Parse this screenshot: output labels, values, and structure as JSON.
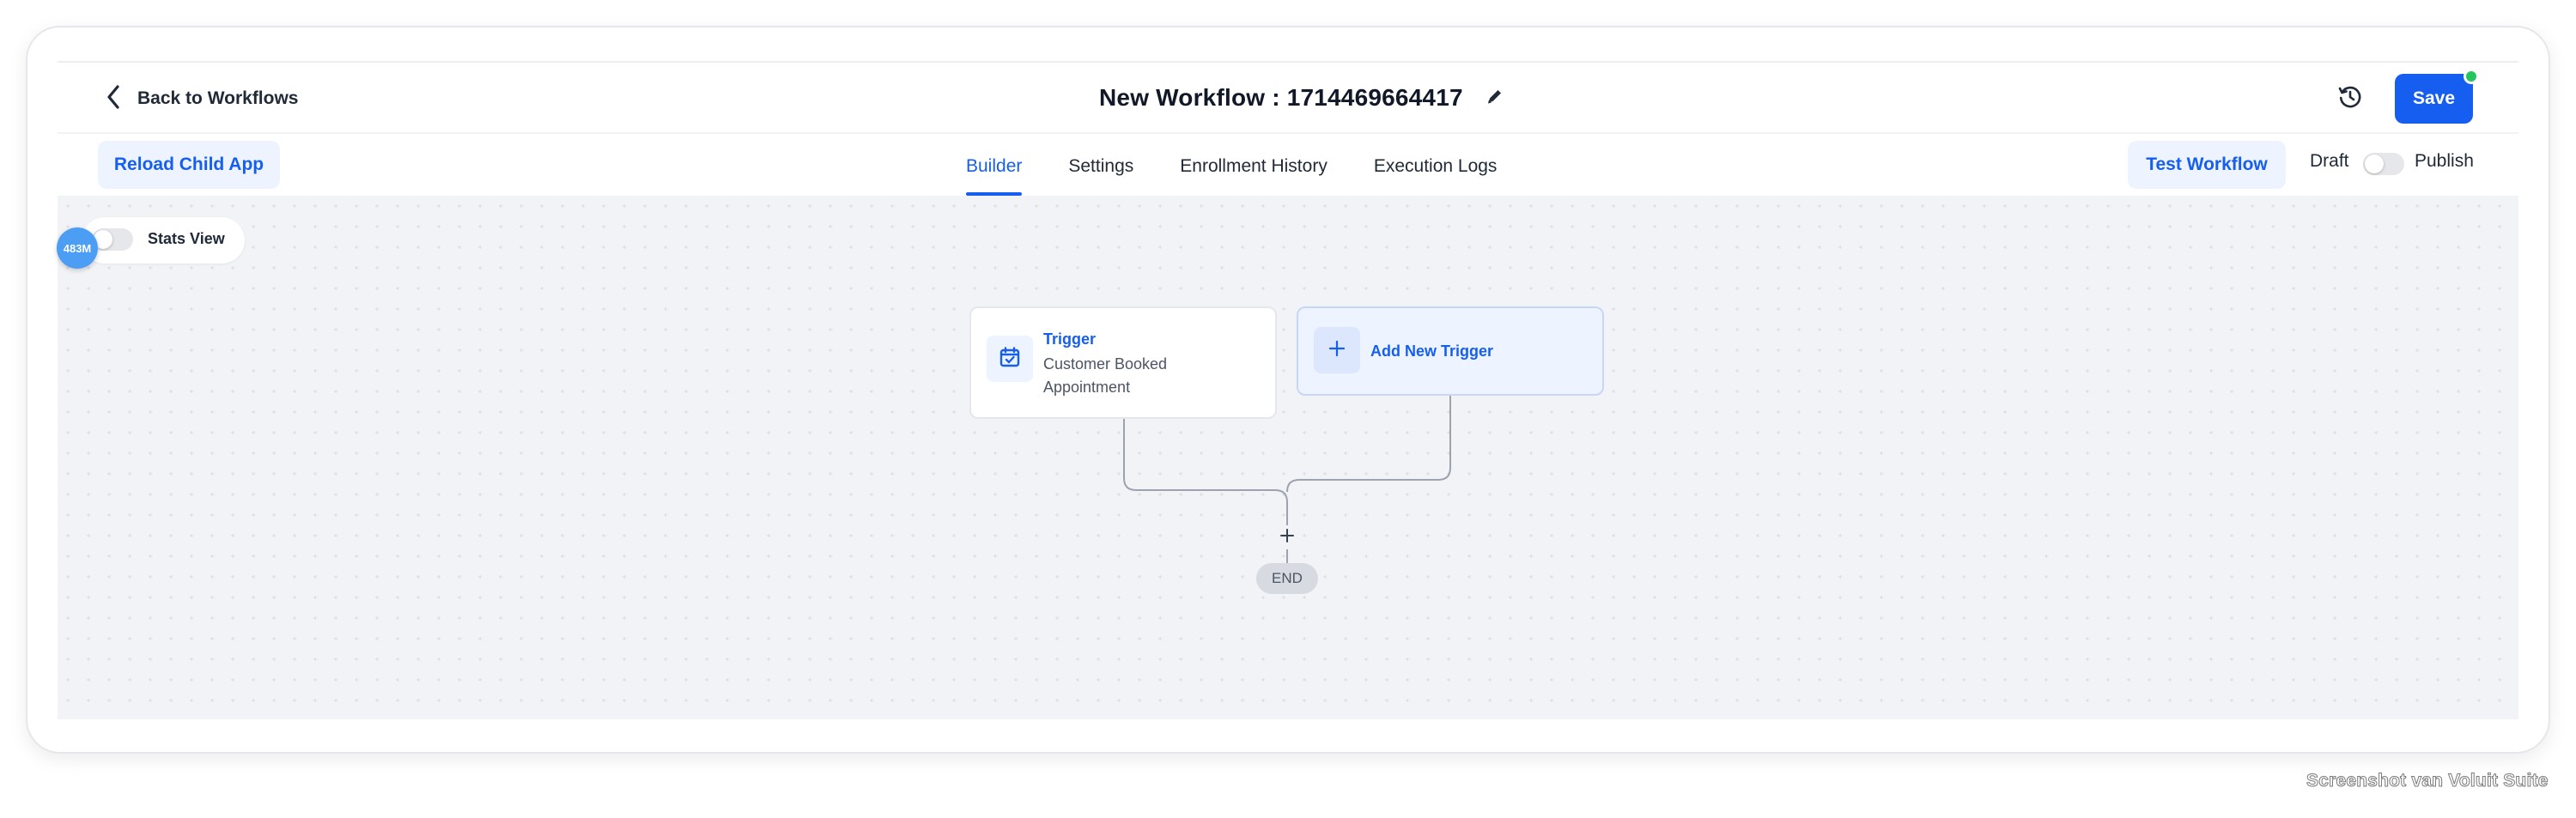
{
  "header": {
    "back_label": "Back to Workflows",
    "title": "New Workflow : 1714469664417",
    "save_label": "Save"
  },
  "toolbar": {
    "reload_label": "Reload Child App",
    "tabs": [
      {
        "label": "Builder",
        "active": true
      },
      {
        "label": "Settings",
        "active": false
      },
      {
        "label": "Enrollment History",
        "active": false
      },
      {
        "label": "Execution Logs",
        "active": false
      }
    ],
    "test_label": "Test Workflow",
    "draft_label": "Draft",
    "publish_label": "Publish",
    "publish_enabled": false
  },
  "canvas": {
    "badge": "483M",
    "stats_label": "Stats View",
    "stats_enabled": false,
    "trigger": {
      "title": "Trigger",
      "description": "Customer Booked Appointment"
    },
    "add_trigger_label": "Add New Trigger",
    "add_step_symbol": "+",
    "end_label": "END"
  },
  "footer": {
    "watermark": "Screenshot van Voluit Suite"
  },
  "colors": {
    "accent": "#155eef",
    "accent_light": "#eef4ff",
    "status_online": "#22c55e",
    "badge": "#4c9ef5",
    "canvas_bg": "#f2f3f6"
  },
  "icons": [
    "chevron-left-icon",
    "edit-pencil-icon",
    "history-clock-icon",
    "calendar-check-icon",
    "plus-icon"
  ]
}
